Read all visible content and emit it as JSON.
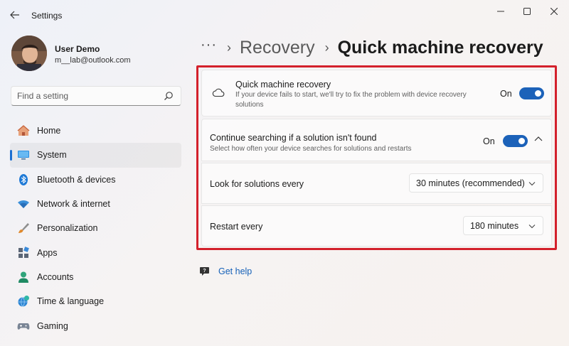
{
  "window": {
    "title": "Settings"
  },
  "user": {
    "name": "User Demo",
    "email": "m__lab@outlook.com"
  },
  "search": {
    "placeholder": "Find a setting"
  },
  "nav": {
    "items": [
      {
        "label": "Home",
        "icon": "home-icon"
      },
      {
        "label": "System",
        "icon": "system-icon",
        "active": true
      },
      {
        "label": "Bluetooth & devices",
        "icon": "bluetooth-icon"
      },
      {
        "label": "Network & internet",
        "icon": "wifi-icon"
      },
      {
        "label": "Personalization",
        "icon": "brush-icon"
      },
      {
        "label": "Apps",
        "icon": "apps-icon"
      },
      {
        "label": "Accounts",
        "icon": "person-icon"
      },
      {
        "label": "Time & language",
        "icon": "clock-globe-icon"
      },
      {
        "label": "Gaming",
        "icon": "gamepad-icon"
      }
    ]
  },
  "breadcrumb": {
    "more": "···",
    "parent": "Recovery",
    "current": "Quick machine recovery"
  },
  "qmr": {
    "title": "Quick machine recovery",
    "description": "If your device fails to start, we'll try to fix the problem with device recovery solutions",
    "toggle_label": "On"
  },
  "continue_search": {
    "title": "Continue searching if a solution isn't found",
    "description": "Select how often your device searches for solutions and restarts",
    "toggle_label": "On"
  },
  "look_for": {
    "label": "Look for solutions every",
    "value": "30 minutes (recommended)"
  },
  "restart": {
    "label": "Restart every",
    "value": "180 minutes"
  },
  "help": {
    "label": "Get help"
  },
  "colors": {
    "accent": "#1c62b9",
    "highlight": "#d3202b",
    "link": "#1561b8"
  }
}
